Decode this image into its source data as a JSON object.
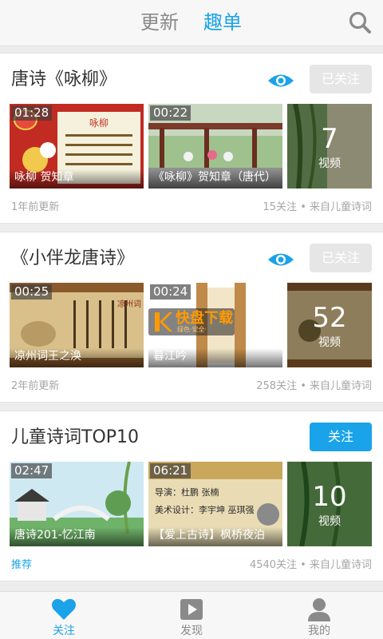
{
  "colors": {
    "accent": "#1aa3e9",
    "muted": "#a6a6a6",
    "title": "#333333"
  },
  "tabs": {
    "update": "更新",
    "fun": "趣单"
  },
  "cards": [
    {
      "title": "唐诗《咏柳》",
      "follow": "已关注",
      "videos": [
        {
          "duration": "01:28",
          "label": "咏柳 贺知章"
        },
        {
          "duration": "00:22",
          "label": "《咏柳》贺知章（唐代）"
        }
      ],
      "count": "7",
      "count_unit": "视频",
      "time": "1年前更新",
      "stats": "15关注 • 来自儿童诗词"
    },
    {
      "title": "《小伴龙唐诗》",
      "follow": "已关注",
      "videos": [
        {
          "duration": "00:25",
          "label": "凉州词王之涣"
        },
        {
          "duration": "00:24",
          "label": "暮江吟"
        }
      ],
      "count": "52",
      "count_unit": "视频",
      "time": "2年前更新",
      "stats": "258关注 • 来自儿童诗词"
    },
    {
      "title": "儿童诗词TOP10",
      "follow": "关注",
      "videos": [
        {
          "duration": "02:47",
          "label": "唐诗201-忆江南"
        },
        {
          "duration": "06:21",
          "label": "【爱上古诗】枫桥夜泊"
        }
      ],
      "count": "10",
      "count_unit": "视频",
      "time": "推荐",
      "stats": "4540关注 • 来自儿童诗词"
    }
  ],
  "thumb_texts": {
    "poem_title": "咏柳",
    "credits_director": "导演：杜鹏 张楠",
    "credits_art": "美术设计：李宇坤 巫琪强",
    "scroll_title": "凉州词"
  },
  "watermark": {
    "text": "快盘下载",
    "sub": "绿色·安全·"
  },
  "nav": {
    "follow": "关注",
    "discover": "发现",
    "mine": "我的"
  }
}
